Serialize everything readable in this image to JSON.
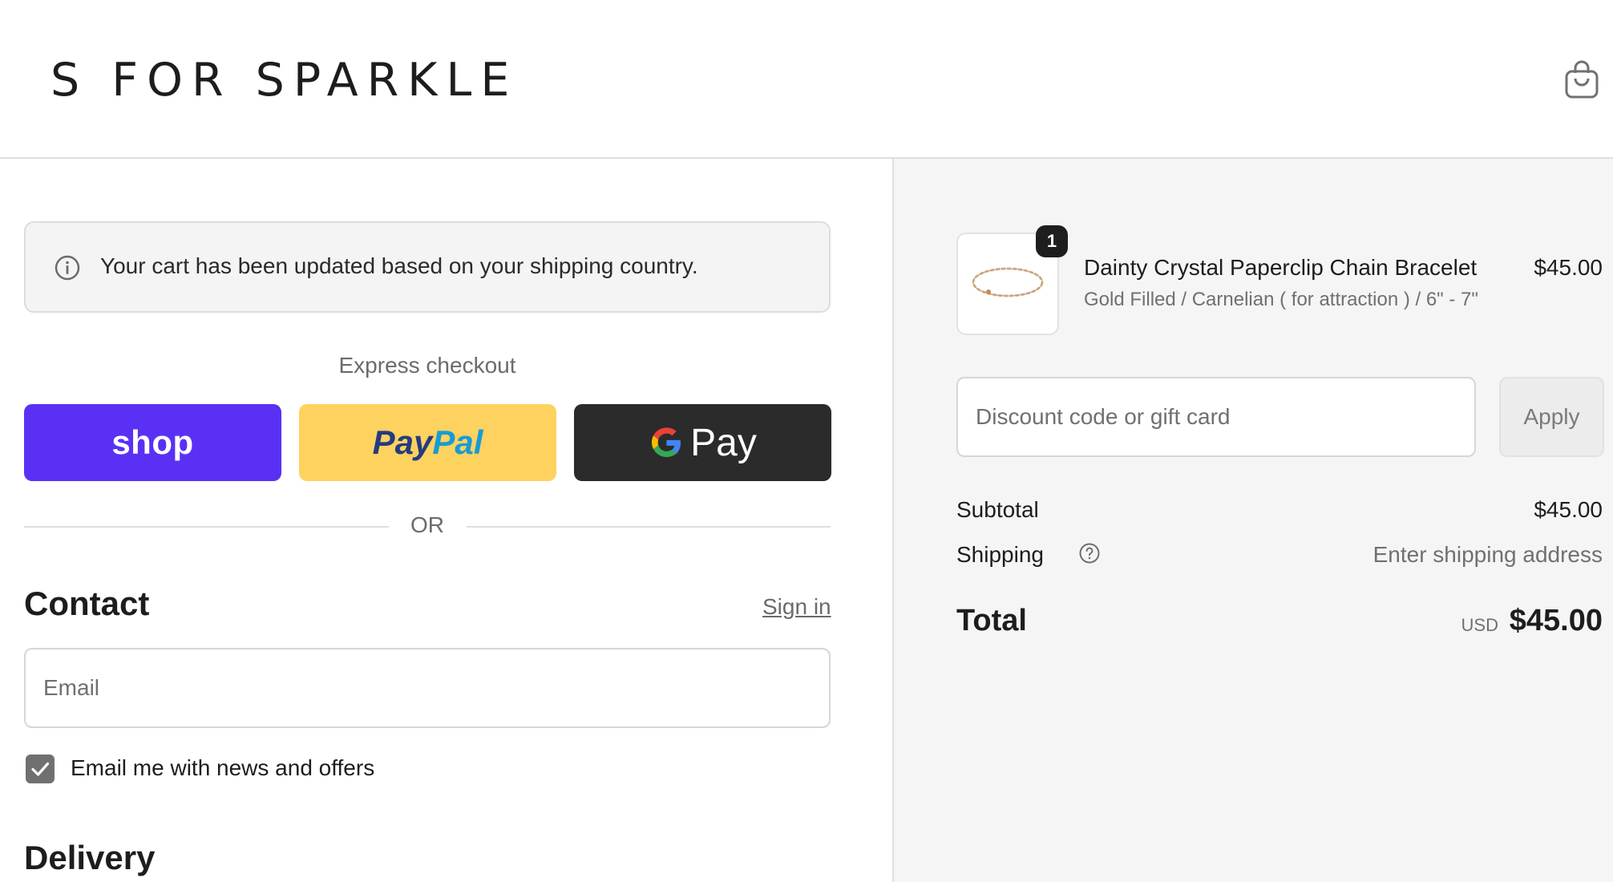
{
  "header": {
    "brand": "S FOR SPARKLE",
    "cart_icon": "shopping-bag-icon"
  },
  "notice": {
    "icon": "info-icon",
    "text": "Your cart has been updated based on your shipping country."
  },
  "express_checkout": {
    "label": "Express checkout",
    "shop_label": "shop",
    "paypal_part1": "Pay",
    "paypal_part2": "Pal",
    "gpay_label": "Pay",
    "divider_text": "OR"
  },
  "contact": {
    "heading": "Contact",
    "sign_in": "Sign in",
    "email_placeholder": "Email",
    "newsletter_label": "Email me with news and offers",
    "newsletter_checked": true
  },
  "delivery": {
    "heading": "Delivery"
  },
  "order_summary": {
    "item": {
      "quantity": "1",
      "name": "Dainty Crystal Paperclip Chain Bracelet",
      "variant": "Gold Filled / Carnelian ( for attraction ) / 6\" - 7\"",
      "price": "$45.00"
    },
    "discount_placeholder": "Discount code or gift card",
    "apply_label": "Apply",
    "subtotal_label": "Subtotal",
    "subtotal_value": "$45.00",
    "shipping_label": "Shipping",
    "shipping_value": "Enter shipping address",
    "total_label": "Total",
    "total_currency": "USD",
    "total_value": "$45.00"
  },
  "colors": {
    "shop_purple": "#5a31f4",
    "paypal_yellow": "#fdd25f",
    "gpay_dark": "#2b2b2b",
    "summary_bg": "#f5f5f5"
  }
}
